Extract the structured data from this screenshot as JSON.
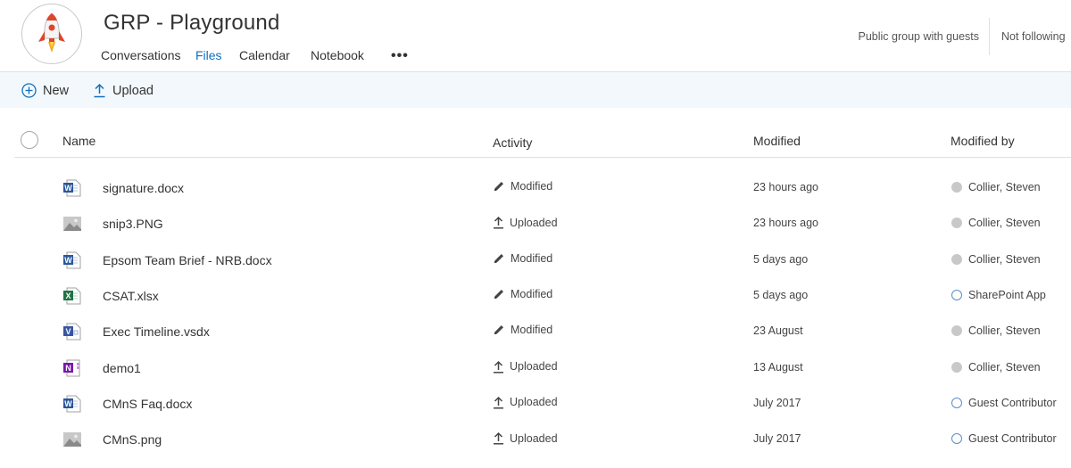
{
  "header": {
    "title": "GRP - Playground",
    "tabs": [
      {
        "label": "Conversations",
        "active": false
      },
      {
        "label": "Files",
        "active": true
      },
      {
        "label": "Calendar",
        "active": false
      },
      {
        "label": "Notebook",
        "active": false
      }
    ],
    "more": "•••",
    "privacy": "Public group with guests",
    "follow": "Not following"
  },
  "commands": {
    "new_label": "New",
    "upload_label": "Upload"
  },
  "columns": {
    "name": "Name",
    "activity": "Activity",
    "modified": "Modified",
    "modified_by": "Modified by"
  },
  "colors": {
    "accent": "#106ebe",
    "word": "#2b579a",
    "excel": "#217346",
    "visio": "#3955a3",
    "onenote": "#7719aa"
  },
  "files": [
    {
      "name": "signature.docx",
      "icon": "word-icon",
      "activity": "Modified",
      "activity_icon": "pencil-icon",
      "modified": "23 hours ago",
      "modified_by": "Collier, Steven",
      "presence": "filled"
    },
    {
      "name": "snip3.PNG",
      "icon": "image-icon",
      "activity": "Uploaded",
      "activity_icon": "upload-icon",
      "modified": "23 hours ago",
      "modified_by": "Collier, Steven",
      "presence": "filled"
    },
    {
      "name": "Epsom Team Brief - NRB.docx",
      "icon": "word-icon",
      "activity": "Modified",
      "activity_icon": "pencil-icon",
      "modified": "5 days ago",
      "modified_by": "Collier, Steven",
      "presence": "filled"
    },
    {
      "name": "CSAT.xlsx",
      "icon": "excel-icon",
      "activity": "Modified",
      "activity_icon": "pencil-icon",
      "modified": "5 days ago",
      "modified_by": "SharePoint App",
      "presence": "ring"
    },
    {
      "name": "Exec Timeline.vsdx",
      "icon": "visio-icon",
      "activity": "Modified",
      "activity_icon": "pencil-icon",
      "modified": "23 August",
      "modified_by": "Collier, Steven",
      "presence": "filled"
    },
    {
      "name": "demo1",
      "icon": "onenote-icon",
      "activity": "Uploaded",
      "activity_icon": "upload-icon",
      "modified": "13 August",
      "modified_by": "Collier, Steven",
      "presence": "filled"
    },
    {
      "name": "CMnS Faq.docx",
      "icon": "word-icon",
      "activity": "Uploaded",
      "activity_icon": "upload-icon",
      "modified": "July 2017",
      "modified_by": "Guest Contributor",
      "presence": "ring"
    },
    {
      "name": "CMnS.png",
      "icon": "image-icon",
      "activity": "Uploaded",
      "activity_icon": "upload-icon",
      "modified": "July 2017",
      "modified_by": "Guest Contributor",
      "presence": "ring"
    }
  ]
}
